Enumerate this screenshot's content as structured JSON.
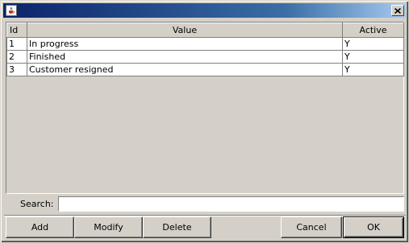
{
  "window": {
    "icon": "java-cup-icon",
    "close_icon": "close-icon",
    "accent_color": "#0a246a"
  },
  "table": {
    "headers": [
      "Id",
      "Value",
      "Active"
    ],
    "rows": [
      [
        "1",
        "In progress",
        "Y"
      ],
      [
        "2",
        "Finished",
        "Y"
      ],
      [
        "3",
        "Customer resigned",
        "Y"
      ]
    ]
  },
  "search": {
    "label": "Search:",
    "value": ""
  },
  "buttons": {
    "add": "Add",
    "modify": "Modify",
    "delete": "Delete",
    "cancel": "Cancel",
    "ok": "OK"
  }
}
